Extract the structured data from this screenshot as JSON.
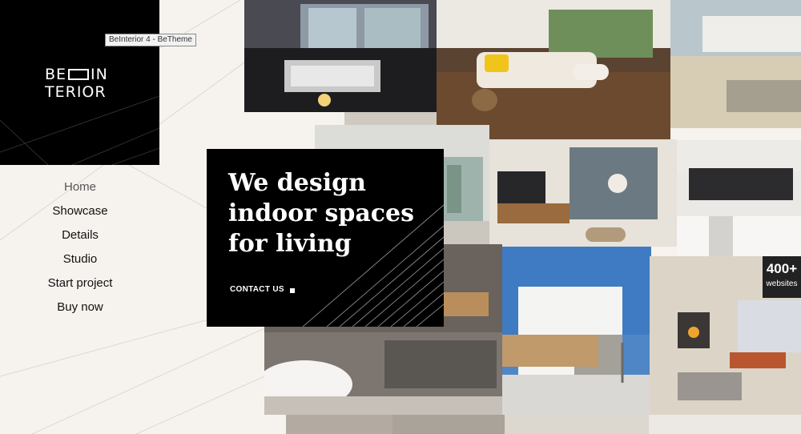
{
  "tooltip": "BeInterior 4 - BeTheme",
  "logo": {
    "line1_left": "BE",
    "line1_right": "IN",
    "line2": "TERIOR"
  },
  "nav": {
    "items": [
      {
        "label": "Home"
      },
      {
        "label": "Showcase"
      },
      {
        "label": "Details"
      },
      {
        "label": "Studio"
      },
      {
        "label": "Start project"
      },
      {
        "label": "Buy now"
      }
    ]
  },
  "hero": {
    "title": "We design indoor spaces for living",
    "cta": "CONTACT US"
  },
  "badge": {
    "count": "400+",
    "label": "websites"
  },
  "colors": {
    "background": "#f6f3ee",
    "dark": "#000000",
    "text": "#111111"
  }
}
